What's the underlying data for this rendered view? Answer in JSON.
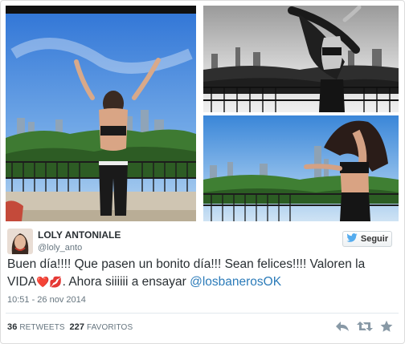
{
  "photos": [
    {
      "name": "photo-balcony-arms-raised"
    },
    {
      "name": "photo-city-skyline-bw"
    },
    {
      "name": "photo-city-skyline-workout"
    }
  ],
  "user": {
    "display_name": "LOLY ANTONIALE",
    "handle": "@loly_anto"
  },
  "follow_button": {
    "label": "Seguir",
    "icon": "twitter-bird-icon"
  },
  "tweet": {
    "text_part1": "Buen día!!!! Que pasen un bonito día!!! Sean felices!!!! Valoren la VIDA",
    "emoji": "❤️💋",
    "text_part2": ". Ahora siiiiii a ensayar ",
    "mention": "@losbanerosOK"
  },
  "timestamp": "10:51 - 26 nov 2014",
  "stats": {
    "retweets_count": "36",
    "retweets_label": "RETWEETS",
    "favorites_count": "227",
    "favorites_label": "FAVORITOS"
  },
  "actions": [
    "reply-icon",
    "retweet-icon",
    "favorite-icon"
  ],
  "colors": {
    "link": "#2b7bb9",
    "text": "#292f33",
    "muted": "#66757f",
    "twitter_blue": "#55acee"
  }
}
